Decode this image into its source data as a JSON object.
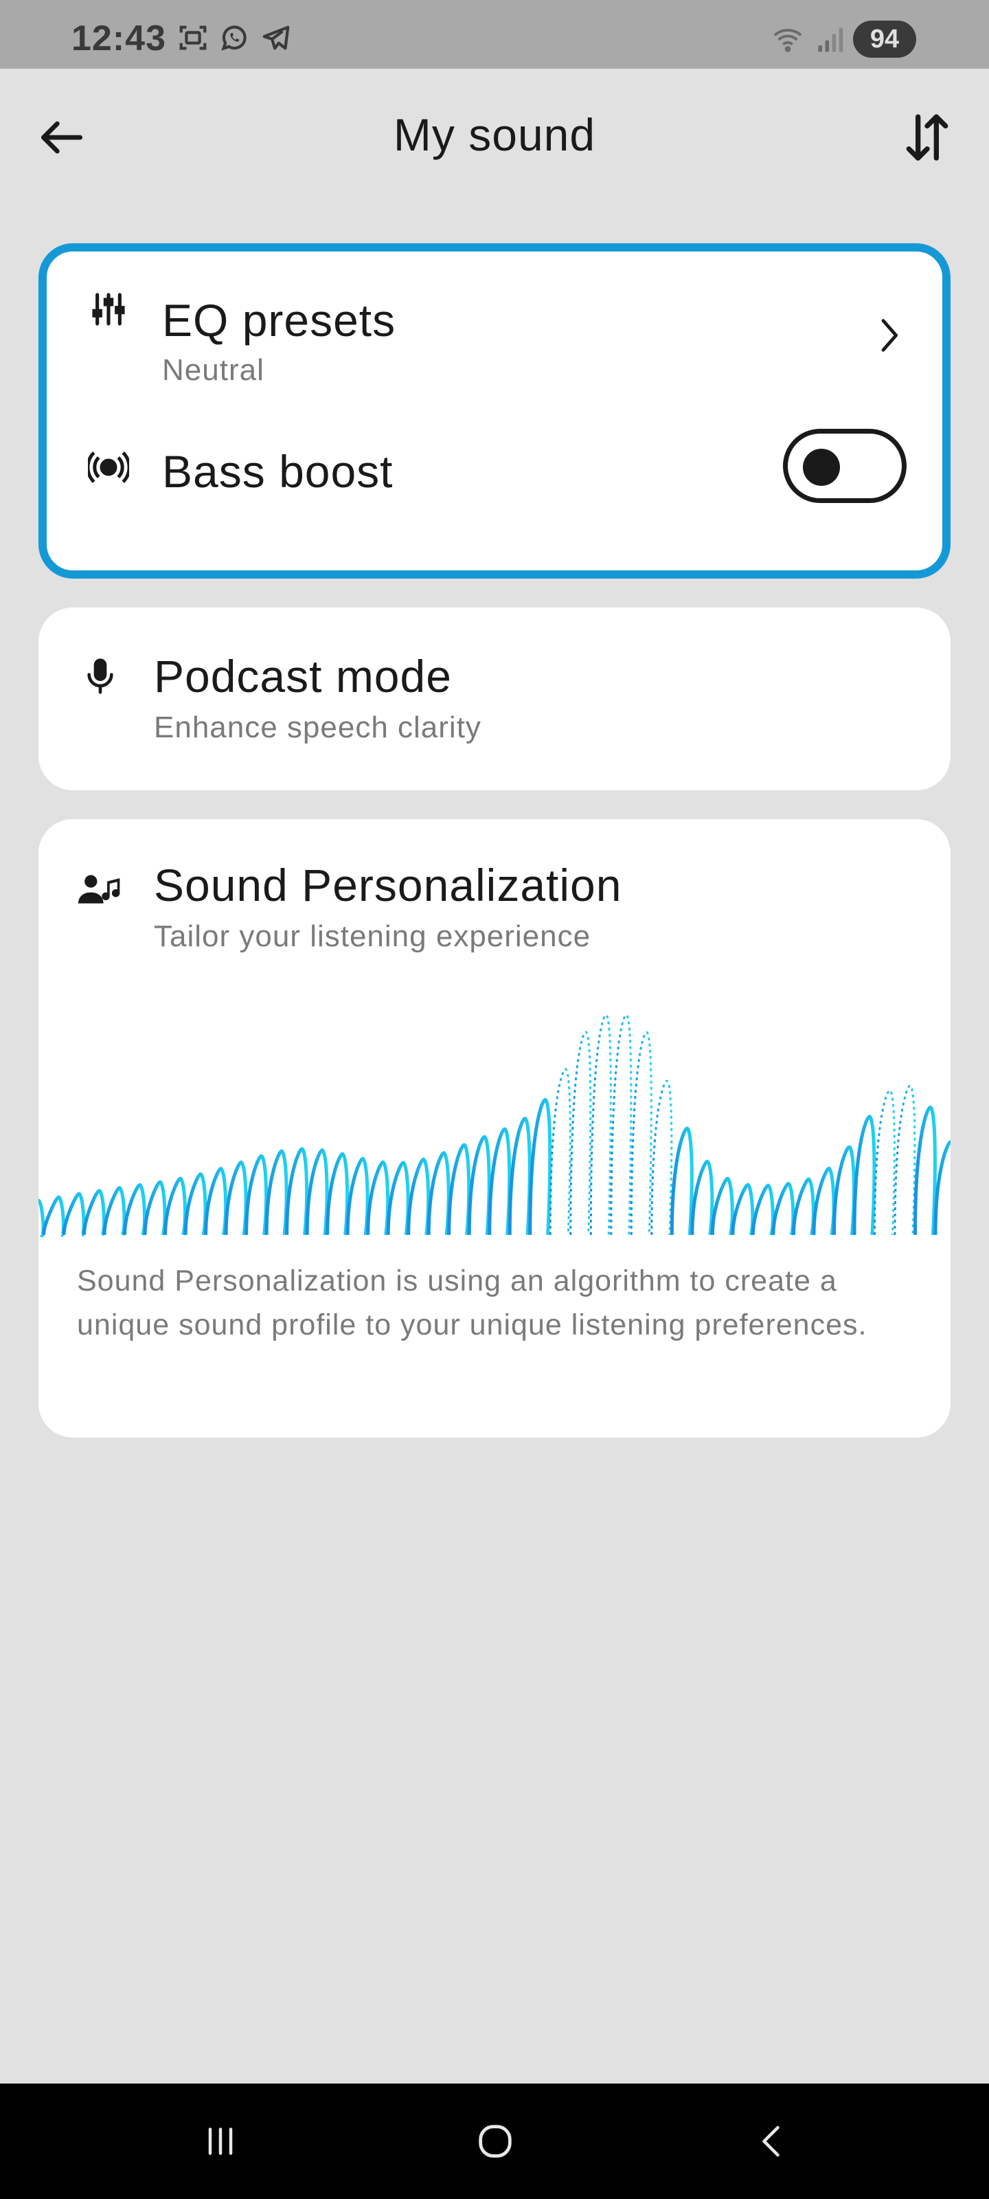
{
  "status_bar": {
    "time": "12:43",
    "battery": "94",
    "left_icons": [
      "screenshot-icon",
      "whatsapp-icon",
      "telegram-icon"
    ],
    "right_icons": [
      "wifi-icon",
      "signal-icon"
    ]
  },
  "app_bar": {
    "title": "My sound",
    "back_icon": "arrow-left-icon",
    "sort_icon": "sort-icon"
  },
  "eq_card": {
    "eq_presets": {
      "title": "EQ presets",
      "subtitle": "Neutral",
      "icon": "sliders-icon"
    },
    "bass_boost": {
      "title": "Bass boost",
      "icon": "speaker-icon",
      "enabled": false
    }
  },
  "podcast_card": {
    "title": "Podcast mode",
    "subtitle": "Enhance speech clarity",
    "icon": "microphone-icon"
  },
  "personalization_card": {
    "title": "Sound Personalization",
    "subtitle": "Tailor your listening experience",
    "icon": "person-music-icon",
    "description": "Sound Personalization is using an algorithm to create a unique sound profile to your unique listening preferences."
  },
  "colors": {
    "accent": "#1599d6",
    "wave_start": "#1a8fe0",
    "wave_end": "#1fd3f0",
    "background": "#e1e1e1"
  },
  "nav_bar": {
    "recents_icon": "recents-icon",
    "home_icon": "home-icon",
    "back_icon": "nav-back-icon"
  }
}
